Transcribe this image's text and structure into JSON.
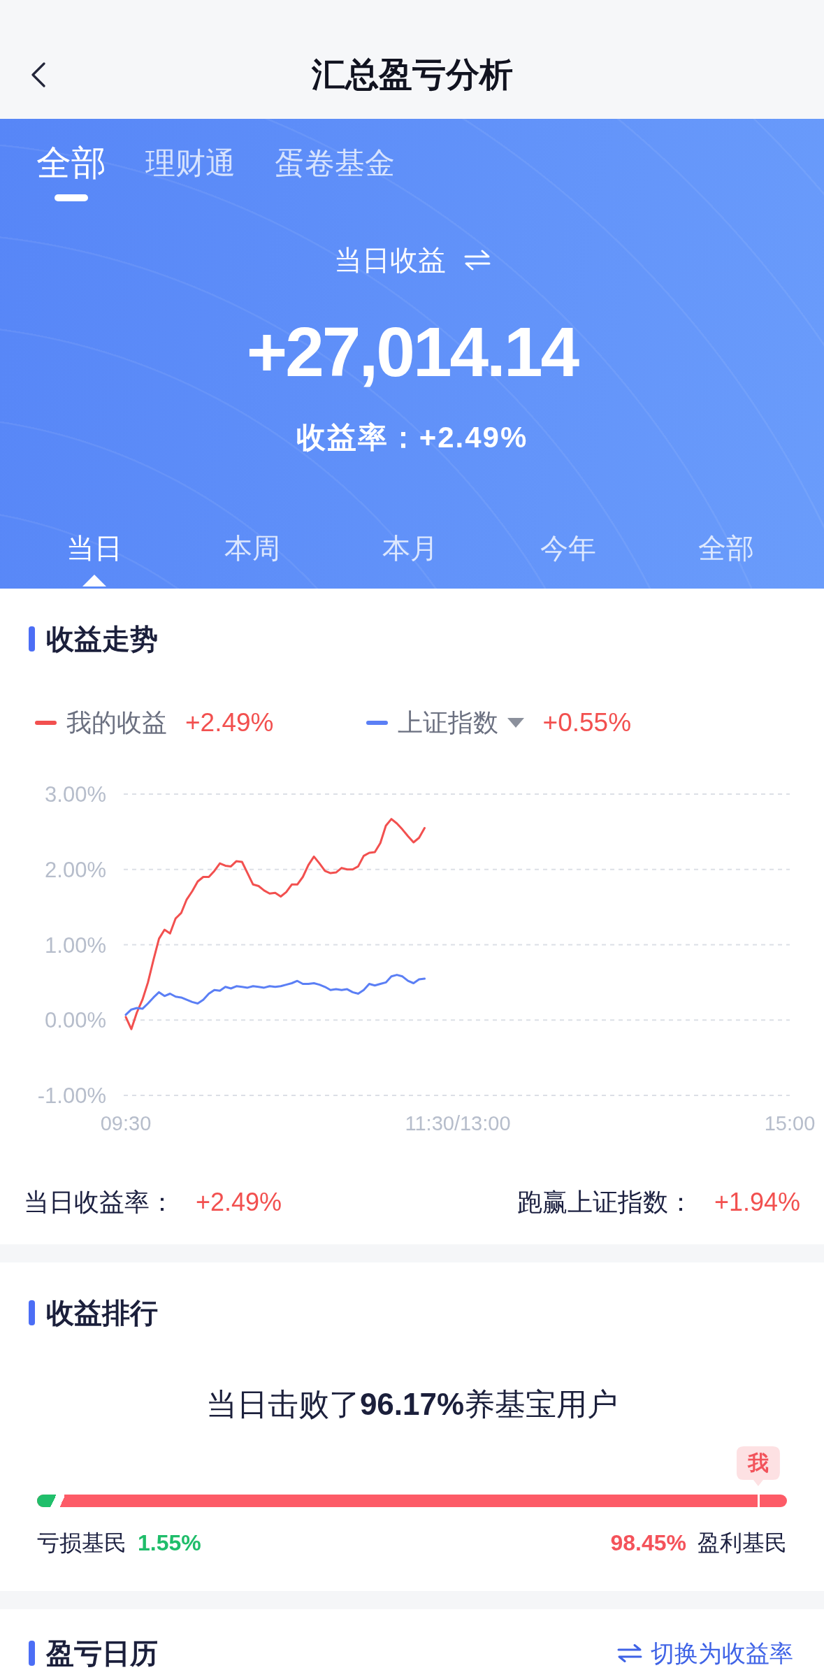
{
  "nav": {
    "title": "汇总盈亏分析"
  },
  "source_tabs": [
    {
      "label": "全部",
      "selected": true
    },
    {
      "label": "理财通",
      "selected": false
    },
    {
      "label": "蛋卷基金",
      "selected": false
    }
  ],
  "summary": {
    "label": "当日收益",
    "amount": "+27,014.14",
    "rate": "收益率：+2.49%"
  },
  "period_tabs": [
    {
      "label": "当日",
      "selected": true
    },
    {
      "label": "本周",
      "selected": false
    },
    {
      "label": "本月",
      "selected": false
    },
    {
      "label": "今年",
      "selected": false
    },
    {
      "label": "全部",
      "selected": false
    }
  ],
  "trend": {
    "title": "收益走势",
    "legend": [
      {
        "value": "+2.49%",
        "dropdown": false
      },
      {
        "value": "+0.55%",
        "dropdown": true
      }
    ],
    "chart_data": {
      "type": "line",
      "grid": true,
      "categories": [
        "09:30",
        null,
        null,
        null,
        null,
        null,
        null,
        null,
        null,
        null,
        null,
        null,
        null,
        null,
        null,
        null,
        null,
        null,
        null,
        null,
        null,
        null,
        null,
        null,
        null,
        null,
        null,
        null,
        null,
        null,
        null,
        null,
        null,
        null,
        null,
        null,
        null,
        null,
        null,
        null,
        null,
        null,
        null,
        null,
        null,
        null,
        null,
        null,
        null,
        null,
        null,
        null,
        null,
        null,
        null,
        null,
        null,
        null,
        null,
        null,
        "11:30/13:00",
        null,
        null,
        null,
        null,
        null,
        null,
        null,
        null,
        null,
        null,
        null,
        null,
        null,
        null,
        null,
        null,
        null,
        null,
        null,
        null,
        null,
        null,
        null,
        null,
        null,
        null,
        null,
        null,
        null,
        null,
        null,
        null,
        null,
        null,
        null,
        null,
        null,
        null,
        null,
        null,
        null,
        null,
        null,
        null,
        null,
        null,
        null,
        null,
        null,
        null,
        null,
        null,
        null,
        null,
        null,
        null,
        null,
        null,
        null,
        "15:00"
      ],
      "series": [
        {
          "name": "我的收益",
          "color": "#f2504f",
          "values": [
            0.04,
            -0.12,
            0.1,
            0.27,
            0.5,
            0.8,
            1.08,
            1.2,
            1.15,
            1.35,
            1.42,
            1.6,
            1.71,
            1.84,
            1.9,
            1.9,
            1.98,
            2.08,
            2.05,
            2.04,
            2.11,
            2.1,
            1.95,
            1.8,
            1.78,
            1.72,
            1.68,
            1.69,
            1.64,
            1.7,
            1.8,
            1.8,
            1.9,
            2.06,
            2.17,
            2.08,
            1.98,
            1.95,
            1.96,
            2.02,
            2.0,
            2.0,
            2.04,
            2.18,
            2.22,
            2.23,
            2.35,
            2.58,
            2.67,
            2.61,
            2.53,
            2.44,
            2.36,
            2.42,
            2.55,
            null,
            null,
            null,
            null,
            null,
            null,
            null,
            null,
            null,
            null,
            null,
            null,
            null,
            null,
            null,
            null,
            null,
            null,
            null,
            null,
            null,
            null,
            null,
            null,
            null,
            null,
            null,
            null,
            null,
            null,
            null,
            null,
            null,
            null,
            null,
            null,
            null,
            null,
            null,
            null,
            null,
            null,
            null,
            null,
            null,
            null,
            null,
            null,
            null,
            null,
            null,
            null,
            null,
            null,
            null,
            null,
            null,
            null,
            null,
            null,
            null,
            null,
            null,
            null,
            null,
            null
          ]
        },
        {
          "name": "上证指数",
          "color": "#5b7ff5",
          "values": [
            0.07,
            0.14,
            0.16,
            0.15,
            0.22,
            0.3,
            0.37,
            0.32,
            0.35,
            0.31,
            0.3,
            0.27,
            0.24,
            0.22,
            0.27,
            0.35,
            0.4,
            0.39,
            0.44,
            0.42,
            0.45,
            0.44,
            0.43,
            0.45,
            0.44,
            0.43,
            0.45,
            0.44,
            0.45,
            0.47,
            0.49,
            0.52,
            0.48,
            0.48,
            0.49,
            0.47,
            0.44,
            0.4,
            0.41,
            0.4,
            0.41,
            0.37,
            0.35,
            0.4,
            0.48,
            0.46,
            0.48,
            0.5,
            0.58,
            0.6,
            0.58,
            0.52,
            0.49,
            0.54,
            0.55,
            null,
            null,
            null,
            null,
            null,
            null,
            null,
            null,
            null,
            null,
            null,
            null,
            null,
            null,
            null,
            null,
            null,
            null,
            null,
            null,
            null,
            null,
            null,
            null,
            null,
            null,
            null,
            null,
            null,
            null,
            null,
            null,
            null,
            null,
            null,
            null,
            null,
            null,
            null,
            null,
            null,
            null,
            null,
            null,
            null,
            null,
            null,
            null,
            null,
            null,
            null,
            null,
            null,
            null,
            null,
            null,
            null,
            null,
            null,
            null,
            null,
            null,
            null,
            null,
            null,
            null
          ]
        }
      ],
      "ylim": [
        -1,
        3
      ],
      "yticks": [
        {
          "value": 3,
          "label": "3.00%"
        },
        {
          "value": 2,
          "label": "2.00%"
        },
        {
          "value": 1,
          "label": "1.00%"
        },
        {
          "value": 0,
          "label": "0.00%"
        },
        {
          "value": -1,
          "label": "-1.00%"
        }
      ]
    },
    "stats": [
      {
        "label": "当日收益率：",
        "value": "+2.49%"
      },
      {
        "label": "跑赢上证指数：",
        "value": "+1.94%"
      }
    ]
  },
  "ranking": {
    "title": "收益排行",
    "summary": "当日击败了**96.17%**养基宝用户",
    "marker": {
      "label": "我",
      "level": 0.9617
    },
    "loss": {
      "label": "亏损基民",
      "value": "1.55%",
      "level": 0.0155
    },
    "profit": {
      "value": "98.45%",
      "label": "盈利基民"
    }
  },
  "calendar": {
    "title": "盈亏日历",
    "toggle": "切换为收益率"
  }
}
